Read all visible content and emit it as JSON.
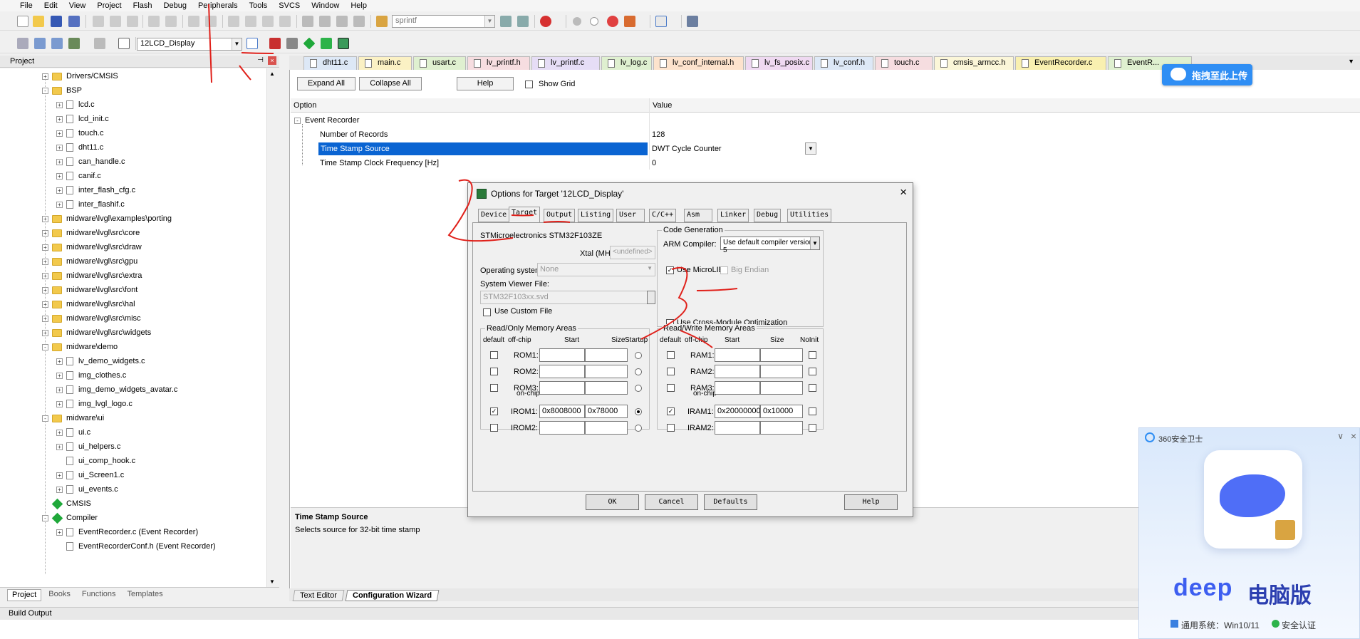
{
  "menu": [
    "File",
    "Edit",
    "View",
    "Project",
    "Flash",
    "Debug",
    "Peripherals",
    "Tools",
    "SVCS",
    "Window",
    "Help"
  ],
  "toolbar": {
    "search_text": "sprintf",
    "target_name": "12LCD_Display"
  },
  "project_panel": {
    "title": "Project",
    "tree": [
      {
        "label": "Drivers/CMSIS",
        "type": "folder",
        "indent": 0,
        "exp": "+"
      },
      {
        "label": "BSP",
        "type": "folder",
        "indent": 0,
        "exp": "-"
      },
      {
        "label": "lcd.c",
        "type": "file",
        "indent": 1,
        "exp": "+"
      },
      {
        "label": "lcd_init.c",
        "type": "file",
        "indent": 1,
        "exp": "+"
      },
      {
        "label": "touch.c",
        "type": "file",
        "indent": 1,
        "exp": "+"
      },
      {
        "label": "dht11.c",
        "type": "file",
        "indent": 1,
        "exp": "+"
      },
      {
        "label": "can_handle.c",
        "type": "file",
        "indent": 1,
        "exp": "+"
      },
      {
        "label": "canif.c",
        "type": "file",
        "indent": 1,
        "exp": "+"
      },
      {
        "label": "inter_flash_cfg.c",
        "type": "file",
        "indent": 1,
        "exp": "+"
      },
      {
        "label": "inter_flashif.c",
        "type": "file",
        "indent": 1,
        "exp": "+"
      },
      {
        "label": "midware\\lvgl\\examples\\porting",
        "type": "folder",
        "indent": 0,
        "exp": "+"
      },
      {
        "label": "midware\\lvgl\\src\\core",
        "type": "folder",
        "indent": 0,
        "exp": "+"
      },
      {
        "label": "midware\\lvgl\\src\\draw",
        "type": "folder",
        "indent": 0,
        "exp": "+"
      },
      {
        "label": "midware\\lvgl\\src\\gpu",
        "type": "folder",
        "indent": 0,
        "exp": "+"
      },
      {
        "label": "midware\\lvgl\\src\\extra",
        "type": "folder",
        "indent": 0,
        "exp": "+"
      },
      {
        "label": "midware\\lvgl\\src\\font",
        "type": "folder",
        "indent": 0,
        "exp": "+"
      },
      {
        "label": "midware\\lvgl\\src\\hal",
        "type": "folder",
        "indent": 0,
        "exp": "+"
      },
      {
        "label": "midware\\lvgl\\src\\misc",
        "type": "folder",
        "indent": 0,
        "exp": "+"
      },
      {
        "label": "midware\\lvgl\\src\\widgets",
        "type": "folder",
        "indent": 0,
        "exp": "+"
      },
      {
        "label": "midware\\demo",
        "type": "folder",
        "indent": 0,
        "exp": "-"
      },
      {
        "label": "lv_demo_widgets.c",
        "type": "file",
        "indent": 1,
        "exp": "+"
      },
      {
        "label": "img_clothes.c",
        "type": "file",
        "indent": 1,
        "exp": "+"
      },
      {
        "label": "img_demo_widgets_avatar.c",
        "type": "file",
        "indent": 1,
        "exp": "+"
      },
      {
        "label": "img_lvgl_logo.c",
        "type": "file",
        "indent": 1,
        "exp": "+"
      },
      {
        "label": "midware\\ui",
        "type": "folder",
        "indent": 0,
        "exp": "-"
      },
      {
        "label": "ui.c",
        "type": "file",
        "indent": 1,
        "exp": "+"
      },
      {
        "label": "ui_helpers.c",
        "type": "file",
        "indent": 1,
        "exp": "+"
      },
      {
        "label": "ui_comp_hook.c",
        "type": "file",
        "indent": 1,
        "exp": ""
      },
      {
        "label": "ui_Screen1.c",
        "type": "file",
        "indent": 1,
        "exp": "+"
      },
      {
        "label": "ui_events.c",
        "type": "file",
        "indent": 1,
        "exp": "+"
      },
      {
        "label": "CMSIS",
        "type": "diamond",
        "indent": 0,
        "exp": ""
      },
      {
        "label": "Compiler",
        "type": "diamond",
        "indent": 0,
        "exp": "-"
      },
      {
        "label": "EventRecorder.c (Event Recorder)",
        "type": "file",
        "indent": 1,
        "exp": "+"
      },
      {
        "label": "EventRecorderConf.h (Event Recorder)",
        "type": "file",
        "indent": 1,
        "exp": ""
      }
    ],
    "tabs": [
      "Project",
      "Books",
      "Functions",
      "Templates"
    ]
  },
  "file_tabs": [
    {
      "label": "dht11.c",
      "color": "#dde8f6"
    },
    {
      "label": "main.c",
      "color": "#fbf1c4"
    },
    {
      "label": "usart.c",
      "color": "#dff0d0"
    },
    {
      "label": "lv_printf.h",
      "color": "#f6dde0"
    },
    {
      "label": "lv_printf.c",
      "color": "#e6ddf6"
    },
    {
      "label": "lv_log.c",
      "color": "#dff0d0"
    },
    {
      "label": "lv_conf_internal.h",
      "color": "#fde3cd"
    },
    {
      "label": "lv_fs_posix.c",
      "color": "#efd9f1"
    },
    {
      "label": "lv_conf.h",
      "color": "#dde8f6"
    },
    {
      "label": "touch.c",
      "color": "#f6dde0"
    },
    {
      "label": "cmsis_armcc.h",
      "color": "#fbf6d8"
    },
    {
      "label": "EventRecorder.c",
      "color": "#f9f0b0"
    },
    {
      "label": "EventR...",
      "color": "#dff0d0"
    }
  ],
  "config_wizard": {
    "buttons": {
      "expand": "Expand All",
      "collapse": "Collapse All",
      "help": "Help",
      "show_grid": "Show Grid"
    },
    "headers": {
      "option": "Option",
      "value": "Value"
    },
    "root": "Event Recorder",
    "rows": [
      {
        "option": "Number of Records",
        "value": "128"
      },
      {
        "option": "Time Stamp Source",
        "value": "DWT Cycle Counter"
      },
      {
        "option": "Time Stamp Clock Frequency [Hz]",
        "value": "0"
      }
    ],
    "desc_title": "Time Stamp Source",
    "desc_text": "Selects source for 32-bit time stamp",
    "editor_tabs": [
      "Text Editor",
      "Configuration Wizard"
    ]
  },
  "upload_badge": "拖拽至此上传",
  "build_output": {
    "title": "Build Output"
  },
  "dialog": {
    "title": "Options for Target '12LCD_Display'",
    "tabs": [
      "Device",
      "Target",
      "Output",
      "Listing",
      "User",
      "C/C++",
      "Asm",
      "Linker",
      "Debug",
      "Utilities"
    ],
    "device": "STMicroelectronics STM32F103ZE",
    "xtal_label": "Xtal (MHz):",
    "xtal_value": "<undefined>",
    "os_label": "Operating system:",
    "os_value": "None",
    "svd_label": "System Viewer File:",
    "svd_value": "STM32F103xx.svd",
    "use_custom_file": "Use Custom File",
    "codegen_title": "Code Generation",
    "arm_compiler_label": "ARM Compiler:",
    "arm_compiler_value": "Use default compiler version 5",
    "use_microlib": "Use MicroLIB",
    "big_endian": "Big Endian",
    "cross_module": "Use Cross-Module Optimization",
    "ro_title": "Read/Only Memory Areas",
    "rw_title": "Read/Write Memory Areas",
    "ro_cols": {
      "default": "default",
      "offchip": "off-chip",
      "start": "Start",
      "size": "Size",
      "startup": "Startup"
    },
    "rw_cols": {
      "default": "default",
      "offchip": "off-chip",
      "start": "Start",
      "size": "Size",
      "noinit": "NoInit"
    },
    "on_chip": "on-chip",
    "ro_rows": [
      {
        "name": "ROM1:",
        "start": "",
        "size": ""
      },
      {
        "name": "ROM2:",
        "start": "",
        "size": ""
      },
      {
        "name": "ROM3:",
        "start": "",
        "size": ""
      },
      {
        "name": "IROM1:",
        "start": "0x8008000",
        "size": "0x78000"
      },
      {
        "name": "IROM2:",
        "start": "",
        "size": ""
      }
    ],
    "rw_rows": [
      {
        "name": "RAM1:",
        "start": "",
        "size": ""
      },
      {
        "name": "RAM2:",
        "start": "",
        "size": ""
      },
      {
        "name": "RAM3:",
        "start": "",
        "size": ""
      },
      {
        "name": "IRAM1:",
        "start": "0x20000000",
        "size": "0x10000"
      },
      {
        "name": "IRAM2:",
        "start": "",
        "size": ""
      }
    ],
    "buttons": {
      "ok": "OK",
      "cancel": "Cancel",
      "defaults": "Defaults",
      "help": "Help"
    }
  },
  "popup": {
    "title": "360安全卫士",
    "brand": "deep",
    "brand_cn": "电脑版",
    "footer_os": "通用系统：Win10/11",
    "footer_cert": "安全认证"
  },
  "colors": {
    "selection": "#0a64d2",
    "ink": "#e0201a",
    "upload": "#2f8ef4",
    "brand": "#3d5ef0"
  }
}
